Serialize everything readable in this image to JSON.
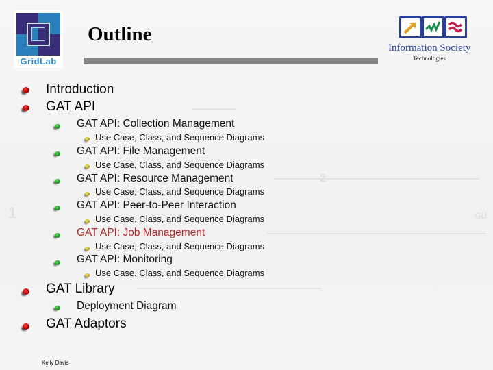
{
  "header": {
    "title": "Outline",
    "left_logo": {
      "text": "GridLab",
      "icon": "gridlab-logo"
    },
    "right_logo": {
      "text": "Information Society",
      "subtext": "Technologies",
      "icon": "ist-logo"
    }
  },
  "outline": {
    "items": [
      {
        "label": "Introduction",
        "level": 1
      },
      {
        "label": "GAT API",
        "level": 1,
        "children": [
          {
            "label": "GAT API: Collection Management",
            "level": 2,
            "children": [
              {
                "label": "Use Case, Class, and Sequence Diagrams",
                "level": 3
              }
            ]
          },
          {
            "label": "GAT API: File Management",
            "level": 2,
            "children": [
              {
                "label": "Use Case, Class, and Sequence Diagrams",
                "level": 3
              }
            ]
          },
          {
            "label": "GAT API: Resource Management",
            "level": 2,
            "children": [
              {
                "label": "Use Case, Class, and Sequence Diagrams",
                "level": 3
              }
            ]
          },
          {
            "label": "GAT API: Peer-to-Peer Interaction",
            "level": 2,
            "children": [
              {
                "label": "Use Case, Class, and Sequence Diagrams",
                "level": 3
              }
            ]
          },
          {
            "label": "GAT API: Job Management",
            "level": 2,
            "highlighted": true,
            "children": [
              {
                "label": "Use Case, Class, and Sequence Diagrams",
                "level": 3
              }
            ]
          },
          {
            "label": "GAT API: Monitoring",
            "level": 2,
            "children": [
              {
                "label": "Use Case, Class, and Sequence Diagrams",
                "level": 3
              }
            ]
          }
        ]
      },
      {
        "label": "GAT Library",
        "level": 1,
        "children": [
          {
            "label": "Deployment Diagram",
            "level": 2
          }
        ]
      },
      {
        "label": "GAT Adaptors",
        "level": 1
      }
    ]
  },
  "footer": {
    "author": "Kelly Davis"
  },
  "colors": {
    "highlight": "#b3262b",
    "title_bar": "#858585",
    "ist_blue": "#2a3f9a",
    "gridlab_blue": "#2b8bc6"
  }
}
